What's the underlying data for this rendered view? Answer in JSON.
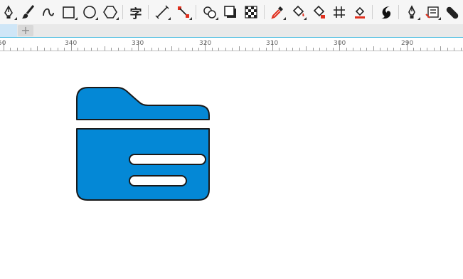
{
  "toolbar": {
    "tools": [
      {
        "name": "pen-tool-icon",
        "has_flyout": true
      },
      {
        "name": "brush-icon",
        "has_flyout": false
      },
      {
        "name": "curve-tool-icon",
        "has_flyout": false
      },
      {
        "name": "rectangle-tool-icon",
        "has_flyout": true
      },
      {
        "name": "ellipse-tool-icon",
        "has_flyout": true
      },
      {
        "name": "polygon-tool-icon",
        "has_flyout": true
      },
      {
        "name": "text-tool-icon",
        "glyph": "字",
        "has_flyout": false
      },
      {
        "name": "line-dimension-icon",
        "has_flyout": true
      },
      {
        "name": "connector-tool-icon",
        "has_flyout": true
      },
      {
        "name": "blend-tool-icon",
        "has_flyout": true
      },
      {
        "name": "drop-shadow-icon",
        "has_flyout": false
      },
      {
        "name": "transparency-icon",
        "has_flyout": false
      },
      {
        "name": "eyedropper-icon",
        "has_flyout": true
      },
      {
        "name": "fill-bucket-icon",
        "has_flyout": true
      },
      {
        "name": "smart-fill-icon",
        "has_flyout": false
      },
      {
        "name": "mesh-fill-icon",
        "has_flyout": false
      },
      {
        "name": "interactive-fill-icon",
        "has_flyout": false
      },
      {
        "name": "logo-icon",
        "has_flyout": false
      },
      {
        "name": "outline-pen-icon",
        "has_flyout": true
      },
      {
        "name": "properties-icon",
        "has_flyout": true
      },
      {
        "name": "capsule-tool-icon",
        "has_flyout": false
      }
    ]
  },
  "tabs": {
    "add_label": "+"
  },
  "ruler": {
    "labels": [
      "50",
      "340",
      "330",
      "320",
      "310",
      "300",
      "290"
    ]
  },
  "canvas": {
    "shape": "folder-icon",
    "fill_color": "#0488d6",
    "stroke_color": "#1a1a1a"
  }
}
